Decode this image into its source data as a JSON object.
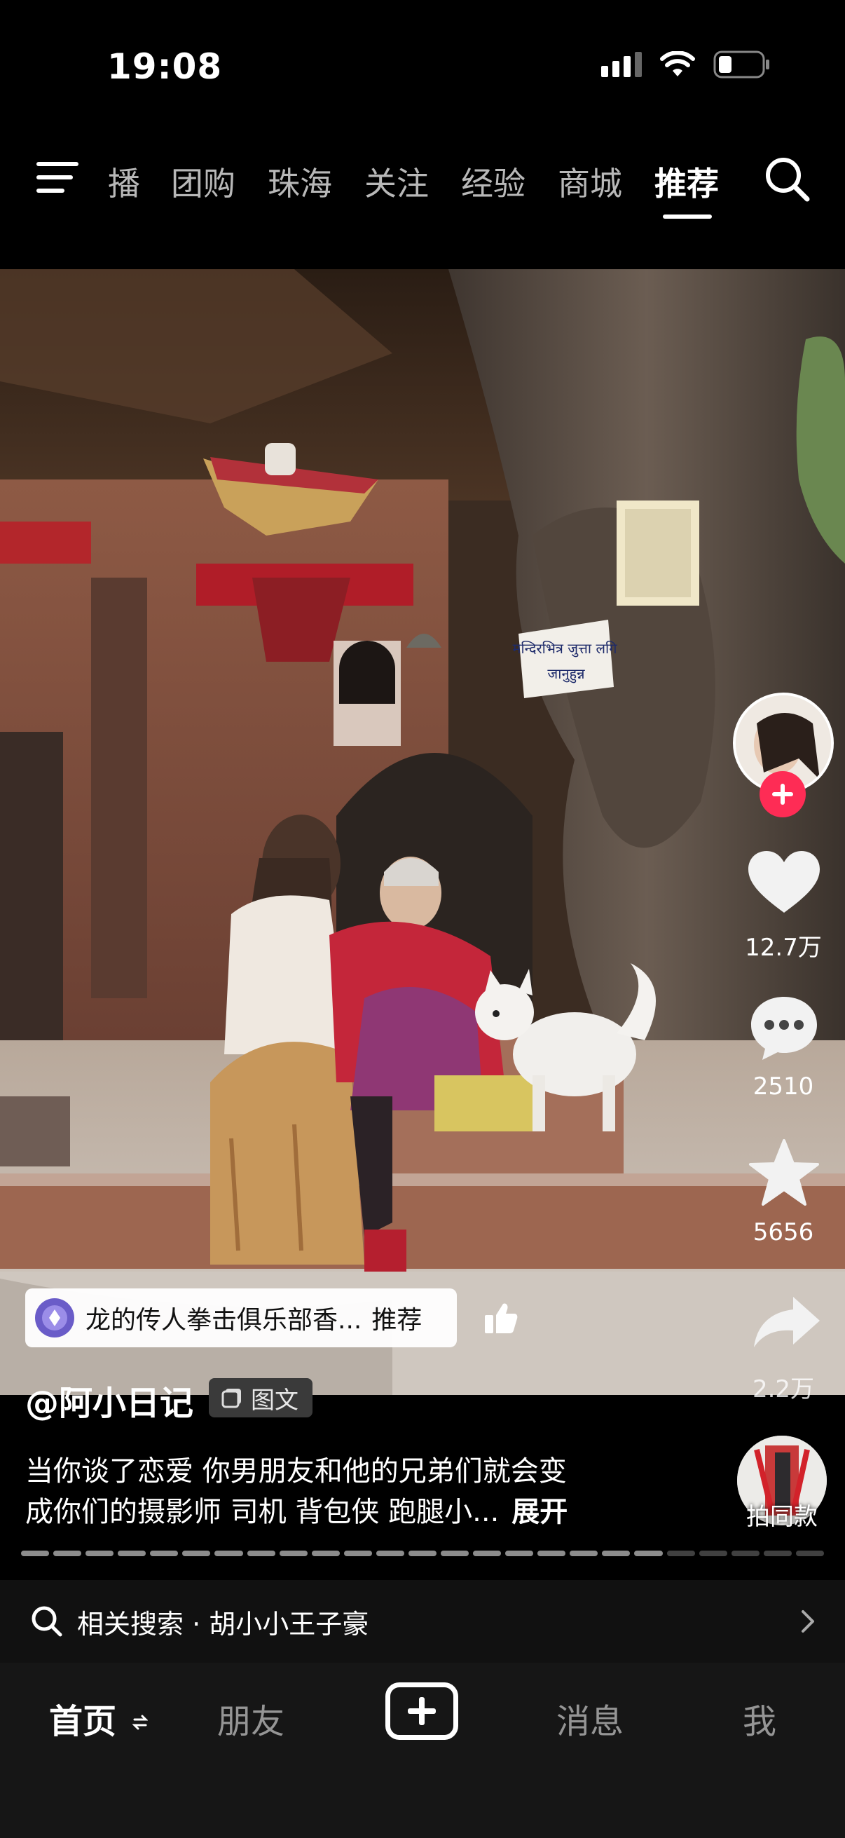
{
  "status_bar": {
    "time": "19:08"
  },
  "top_nav": {
    "tabs": [
      {
        "label": "播"
      },
      {
        "label": "团购"
      },
      {
        "label": "珠海"
      },
      {
        "label": "关注"
      },
      {
        "label": "经验"
      },
      {
        "label": "商城"
      },
      {
        "label": "推荐"
      }
    ],
    "active_tab": "推荐"
  },
  "photo": {
    "sign_text_line1": "मन्दिरभित्र जुत्ता लगि",
    "sign_text_line2": "जानुहुन्न"
  },
  "right_rail": {
    "like_count": "12.7万",
    "comment_count": "2510",
    "favorite_count": "5656",
    "share_count": "2.2万"
  },
  "promo_chip": {
    "text": "龙的传人拳击俱乐部香...",
    "suffix": "推荐"
  },
  "post": {
    "author": "@阿小日记",
    "tag": "图文",
    "caption_line1": "当你谈了恋爱 你男朋友和他的兄弟们就会变",
    "caption_line2": "成你们的摄影师 司机 背包侠 跑腿小...",
    "expand_label": "展开",
    "same_style_label": "拍同款"
  },
  "related_search": {
    "label": "相关搜索 · 胡小小王子豪"
  },
  "bottom_nav": {
    "home": "首页",
    "friends": "朋友",
    "messages": "消息",
    "me": "我"
  },
  "colors": {
    "accent_red": "#fe2c55",
    "background": "#000000",
    "bottom_bar": "#161616"
  }
}
